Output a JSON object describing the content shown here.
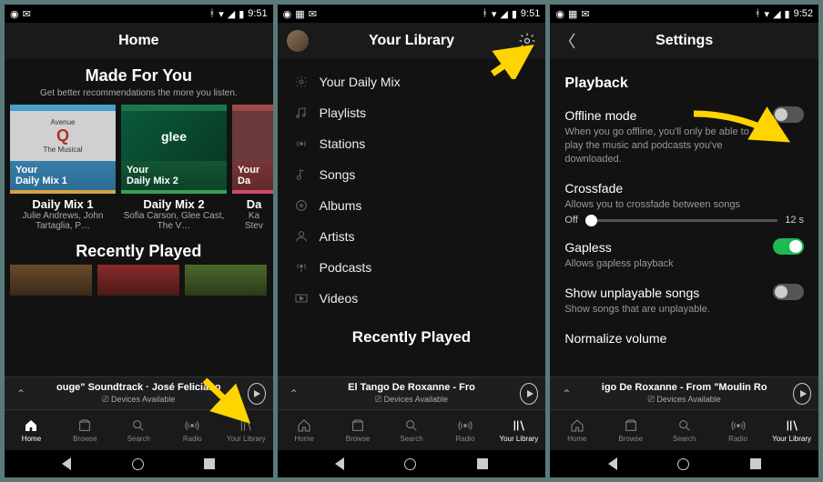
{
  "status": {
    "time": "9:51",
    "time3": "9:52"
  },
  "screen1": {
    "title": "Home",
    "made_for_you": {
      "heading": "Made For You",
      "subtitle": "Get better recommendations the more you listen.",
      "cards": [
        {
          "cover_top": "Avenue",
          "cover_mid": "Q",
          "cover_bot": "The Musical",
          "mix_label": "Your\nDaily Mix 1",
          "title": "Daily Mix 1",
          "sub": "Julie Andrews, John Tartaglia, P…"
        },
        {
          "cover_text": "glee",
          "mix_label": "Your\nDaily Mix 2",
          "title": "Daily Mix 2",
          "sub": "Sofia Carson, Glee Cast, The V…"
        },
        {
          "mix_label": "Your\nDa",
          "title": "Da",
          "sub_a": "Ka",
          "sub_b": "Stev"
        }
      ]
    },
    "recently_played": "Recently Played",
    "now_playing": {
      "track": "ouge\" Soundtrack · José Feliciano",
      "devices": "Devices Available"
    }
  },
  "screen2": {
    "title": "Your Library",
    "items": [
      {
        "label": "Your Daily Mix"
      },
      {
        "label": "Playlists"
      },
      {
        "label": "Stations"
      },
      {
        "label": "Songs"
      },
      {
        "label": "Albums"
      },
      {
        "label": "Artists"
      },
      {
        "label": "Podcasts"
      },
      {
        "label": "Videos"
      }
    ],
    "recently_played": "Recently Played",
    "now_playing": {
      "track": "El Tango De Roxanne - Fro",
      "devices": "Devices Available"
    }
  },
  "screen3": {
    "title": "Settings",
    "section": "Playback",
    "offline": {
      "label": "Offline mode",
      "desc": "When you go offline, you'll only be able to play the music and podcasts you've downloaded."
    },
    "crossfade": {
      "label": "Crossfade",
      "desc": "Allows you to crossfade between songs",
      "min": "Off",
      "max": "12 s"
    },
    "gapless": {
      "label": "Gapless",
      "desc": "Allows gapless playback"
    },
    "unplayable": {
      "label": "Show unplayable songs",
      "desc": "Show songs that are unplayable."
    },
    "normalize": {
      "label": "Normalize volume"
    },
    "now_playing": {
      "track": "igo De Roxanne - From \"Moulin Ro",
      "devices": "Devices Available"
    }
  },
  "nav": {
    "items": [
      "Home",
      "Browse",
      "Search",
      "Radio",
      "Your Library"
    ]
  }
}
